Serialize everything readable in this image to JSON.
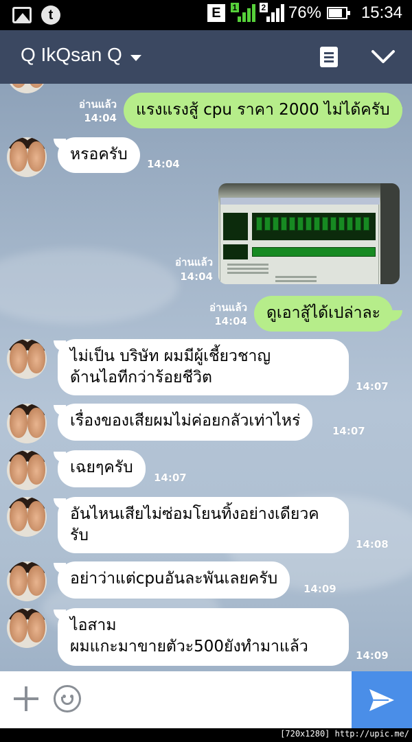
{
  "status_bar": {
    "network_label": "E",
    "sim1_label": "1",
    "sim2_label": "2",
    "battery_percent": "76%",
    "time": "15:34"
  },
  "header": {
    "title": "Q IkQsan Q"
  },
  "messages": [
    {
      "side": "out",
      "text": "แรงแรงสู้ cpu ราคา 2000 ไม่ได้ครับ",
      "read": "อ่านแล้ว",
      "time": "14:04"
    },
    {
      "side": "in",
      "text": "หรอครับ",
      "time": "14:04"
    },
    {
      "side": "out",
      "type": "image",
      "read": "อ่านแล้ว",
      "time": "14:04"
    },
    {
      "side": "out",
      "text": "ดูเอาสู้ได้เปล่าละ",
      "read": "อ่านแล้ว",
      "time": "14:04"
    },
    {
      "side": "in",
      "lines": [
        "ไม่เป็น บริษัท ผมมีผู้เชี้ยวชาญ",
        "ด้านไอทีกว่าร้อยชีวิต"
      ],
      "time": "14:07"
    },
    {
      "side": "in",
      "text": "เรื่องของเสียผมไม่ค่อยกลัวเท่าไหร่",
      "time": "14:07"
    },
    {
      "side": "in",
      "text": "เฉยๆครับ",
      "time": "14:07"
    },
    {
      "side": "in",
      "lines": [
        "อันไหนเสียไม่ซ่อมโยนทิ้งอย่างเดียวค",
        "รับ"
      ],
      "time": "14:08"
    },
    {
      "side": "in",
      "text": "อย่าว่าแต่cpuอันละพันเลยครับ",
      "time": "14:09"
    },
    {
      "side": "in",
      "lines": [
        "ไอสาม",
        "ผมแกะมาขายตัวะ500ยังทำมาแล้ว"
      ],
      "time": "14:09"
    }
  ],
  "footer": {
    "watermark": "[720x1280] http://upic.me/"
  },
  "colors": {
    "header_bg": "#3b4861",
    "outgoing_bubble": "#b6ed8a",
    "incoming_bubble": "#ffffff",
    "send_button": "#4a8ee8"
  },
  "icons": [
    "image-icon",
    "t-app-icon",
    "signal-icon",
    "battery-icon",
    "dropdown-caret-icon",
    "note-icon",
    "chevron-down-icon",
    "plus-icon",
    "emoji-icon",
    "send-icon"
  ]
}
